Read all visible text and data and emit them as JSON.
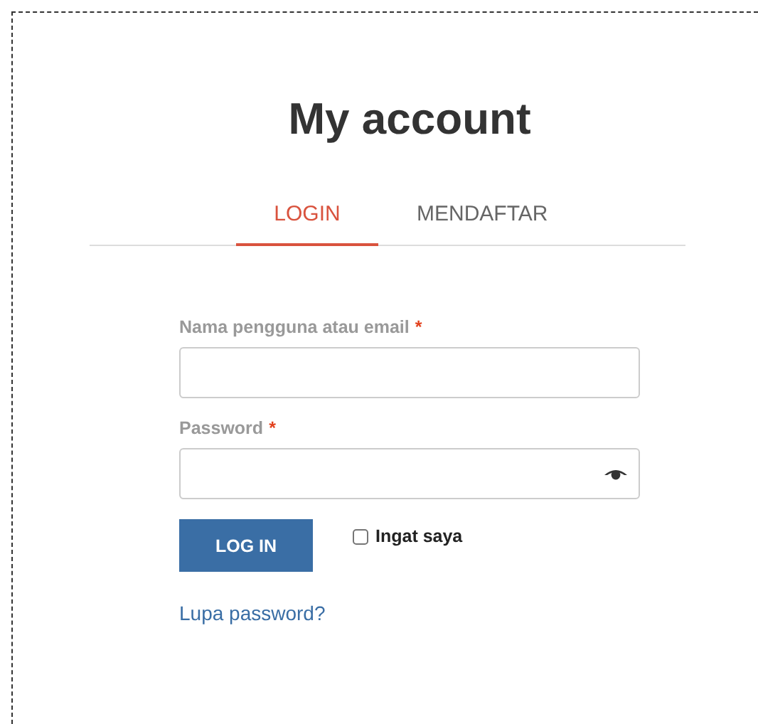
{
  "title": "My account",
  "tabs": [
    {
      "label": "LOGIN",
      "selected": true
    },
    {
      "label": "MENDAFTAR",
      "selected": false
    }
  ],
  "fields": [
    {
      "label": "Nama pengguna atau email",
      "required_mark": "*",
      "kind": "text"
    },
    {
      "label": "Password",
      "required_mark": "*",
      "kind": "password"
    }
  ],
  "login_button": "LOG IN",
  "remember": {
    "label": "Ingat saya",
    "checked": false
  },
  "forgot_link": "Lupa password?"
}
